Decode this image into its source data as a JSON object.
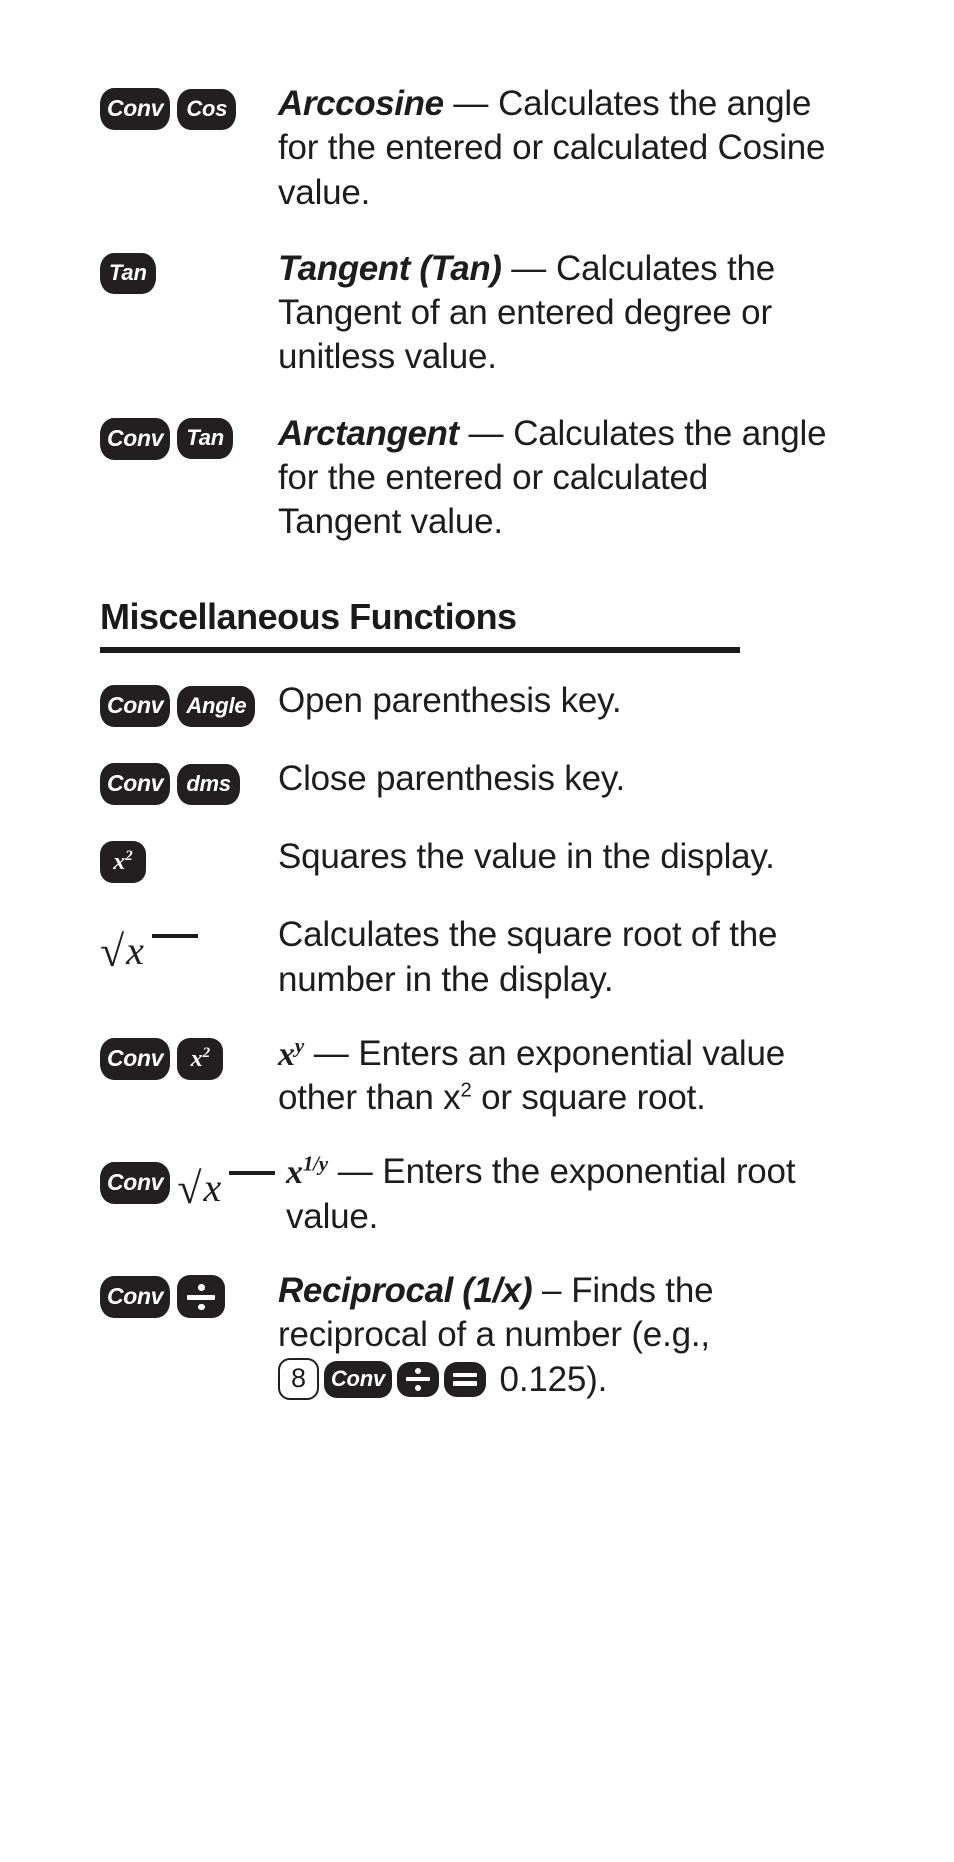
{
  "document": {
    "entries_top": [
      {
        "keys": [
          {
            "type": "key",
            "label": "Conv",
            "style": "conv"
          },
          {
            "type": "key",
            "label": "Cos",
            "style": "lbl"
          }
        ],
        "term": "Arccosine",
        "dash": " — ",
        "text": "Calculates the angle for the entered or calculated Cosine value."
      },
      {
        "keys": [
          {
            "type": "key",
            "label": "Tan",
            "style": "lbl"
          }
        ],
        "term": "Tangent (Tan)",
        "dash": " — ",
        "text": "Calculates the Tangent of an entered degree or unitless value."
      },
      {
        "keys": [
          {
            "type": "key",
            "label": "Conv",
            "style": "conv"
          },
          {
            "type": "key",
            "label": "Tan",
            "style": "lbl"
          }
        ],
        "term": "Arctangent",
        "dash": " — ",
        "text": "Calculates the angle for the entered or calculated Tangent value."
      }
    ],
    "section": {
      "heading": "Miscellaneous Functions"
    },
    "entries_misc": [
      {
        "keys": [
          {
            "type": "key",
            "label": "Conv",
            "style": "conv"
          },
          {
            "type": "key",
            "label": "Angle",
            "style": "lbl"
          }
        ],
        "text": "Open parenthesis key."
      },
      {
        "keys": [
          {
            "type": "key",
            "label": "Conv",
            "style": "conv"
          },
          {
            "type": "key",
            "label": "dms",
            "style": "lbl"
          }
        ],
        "text": "Close parenthesis key."
      },
      {
        "keys": [
          {
            "type": "key",
            "label": "x2",
            "style": "sq"
          }
        ],
        "text": "Squares the value in the display."
      },
      {
        "keys": [
          {
            "type": "radical",
            "label": "sqrt-x"
          }
        ],
        "text": "Calculates the square root of the number in the display."
      },
      {
        "keys": [
          {
            "type": "key",
            "label": "Conv",
            "style": "conv"
          },
          {
            "type": "key",
            "label": "x2",
            "style": "sq"
          }
        ],
        "math": "x",
        "math_sup": "y",
        "dash": " — ",
        "text_a": "Enters an exponential value other than x",
        "text_sup": "2",
        "text_b": " or square root."
      },
      {
        "keys": [
          {
            "type": "key",
            "label": "Conv",
            "style": "conv"
          },
          {
            "type": "radical",
            "label": "sqrt-x"
          }
        ],
        "math": "x",
        "math_sup": "1/y",
        "dash": " — ",
        "text": "Enters the exponential root value."
      },
      {
        "keys": [
          {
            "type": "key",
            "label": "Conv",
            "style": "conv"
          },
          {
            "type": "key",
            "label": "divide",
            "style": "glyph"
          }
        ],
        "term": "Reciprocal (1/x)",
        "dash": " – ",
        "text_a": "Finds the reciprocal of a number (e.g., ",
        "inline_keys": [
          {
            "label": "8",
            "style": "outline"
          },
          {
            "label": "Conv",
            "style": "conv"
          },
          {
            "label": "divide",
            "style": "glyph"
          },
          {
            "label": "equals",
            "style": "glyph"
          }
        ],
        "text_b": " 0.125)."
      }
    ],
    "colors": {
      "key_fill": "#231f20",
      "key_text": "#ffffff",
      "body_text": "#1d1d1d",
      "rule": "#1a1a1a",
      "page_background": "#ffffff"
    }
  }
}
